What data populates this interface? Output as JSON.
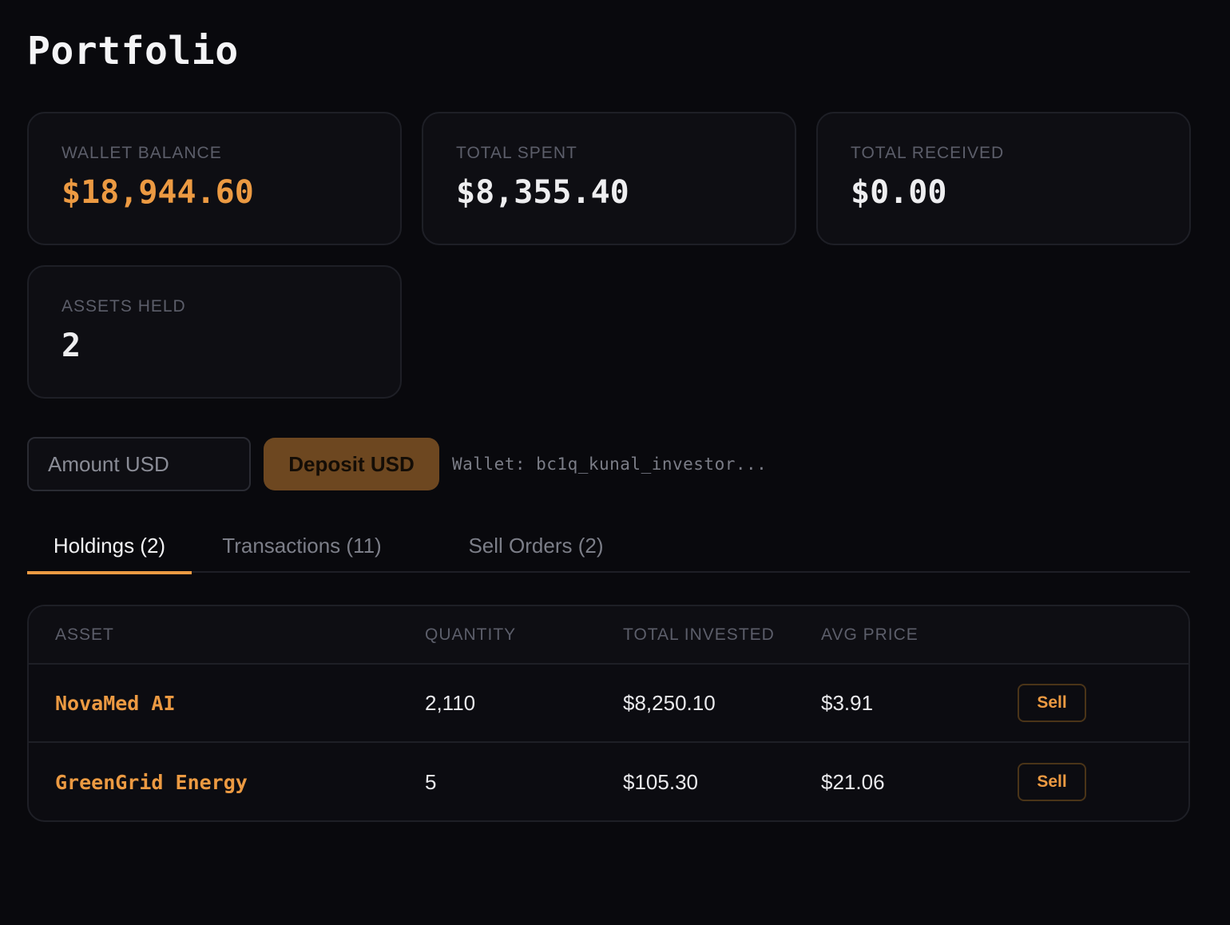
{
  "page": {
    "title": "Portfolio"
  },
  "stats": [
    {
      "label": "WALLET BALANCE",
      "value": "$18,944.60",
      "accent": true
    },
    {
      "label": "TOTAL SPENT",
      "value": "$8,355.40"
    },
    {
      "label": "TOTAL RECEIVED",
      "value": "$0.00"
    },
    {
      "label": "ASSETS HELD",
      "value": "2"
    }
  ],
  "deposit": {
    "placeholder": "Amount USD",
    "button_label": "Deposit USD",
    "wallet_text": "Wallet: bc1q_kunal_investor..."
  },
  "tabs": [
    {
      "label": "Holdings (2)",
      "active": true
    },
    {
      "label": "Transactions (11)"
    },
    {
      "label": "Sell Orders (2)"
    }
  ],
  "table": {
    "headers": [
      "ASSET",
      "QUANTITY",
      "TOTAL INVESTED",
      "AVG PRICE"
    ],
    "rows": [
      {
        "asset": "NovaMed AI",
        "quantity": "2,110",
        "total_invested": "$8,250.10",
        "avg_price": "$3.91",
        "action": "Sell"
      },
      {
        "asset": "GreenGrid Energy",
        "quantity": "5",
        "total_invested": "$105.30",
        "avg_price": "$21.06",
        "action": "Sell"
      }
    ]
  },
  "colors": {
    "accent": "#ec9a42",
    "background": "#09090d",
    "card": "#0e0e13",
    "border": "#1e1f26"
  }
}
